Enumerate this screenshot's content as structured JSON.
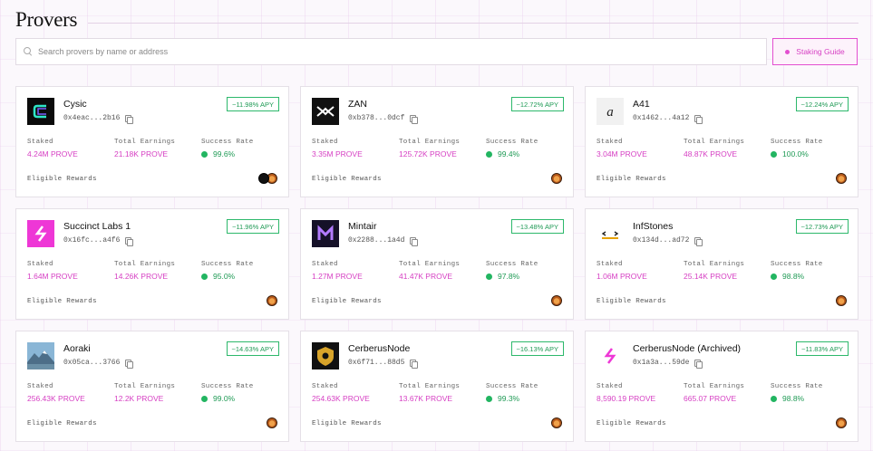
{
  "page": {
    "title": "Provers",
    "search_placeholder": "Search provers by name or address",
    "staking_guide_label": "Staking Guide"
  },
  "labels": {
    "staked": "Staked",
    "total_earnings": "Total Earnings",
    "success_rate": "Success Rate",
    "eligible_rewards": "Eligible Rewards"
  },
  "provers": [
    {
      "name": "Cysic",
      "address": "0x4eac...2b16",
      "apy": "~11.98% APY",
      "staked": "4.24M PROVE",
      "earnings": "21.18K PROVE",
      "success": "99.6%",
      "logo": "cysic-logo",
      "rewards": [
        "dark-token-icon",
        "prove-token-icon"
      ]
    },
    {
      "name": "ZAN",
      "address": "0xb378...0dcf",
      "apy": "~12.72% APY",
      "staked": "3.35M PROVE",
      "earnings": "125.72K PROVE",
      "success": "99.4%",
      "logo": "zan-logo",
      "rewards": [
        "prove-token-icon"
      ]
    },
    {
      "name": "A41",
      "address": "0x1462...4a12",
      "apy": "~12.24% APY",
      "staked": "3.04M PROVE",
      "earnings": "48.87K PROVE",
      "success": "100.0%",
      "logo": "a41-logo",
      "rewards": [
        "prove-token-icon"
      ]
    },
    {
      "name": "Succinct Labs 1",
      "address": "0x16fc...a4f6",
      "apy": "~11.96% APY",
      "staked": "1.64M PROVE",
      "earnings": "14.26K PROVE",
      "success": "95.0%",
      "logo": "succinct-logo",
      "rewards": [
        "prove-token-icon"
      ]
    },
    {
      "name": "Mintair",
      "address": "0x2288...1a4d",
      "apy": "~13.48% APY",
      "staked": "1.27M PROVE",
      "earnings": "41.47K PROVE",
      "success": "97.8%",
      "logo": "mintair-logo",
      "rewards": [
        "prove-token-icon"
      ]
    },
    {
      "name": "InfStones",
      "address": "0x134d...ad72",
      "apy": "~12.73% APY",
      "staked": "1.06M PROVE",
      "earnings": "25.14K PROVE",
      "success": "98.8%",
      "logo": "infstones-logo",
      "rewards": [
        "prove-token-icon"
      ]
    },
    {
      "name": "Aoraki",
      "address": "0x05ca...3766",
      "apy": "~14.63% APY",
      "staked": "256.43K PROVE",
      "earnings": "12.2K PROVE",
      "success": "99.0%",
      "logo": "aoraki-logo",
      "rewards": [
        "prove-token-icon"
      ]
    },
    {
      "name": "CerberusNode",
      "address": "0x6f71...88d5",
      "apy": "~16.13% APY",
      "staked": "254.63K PROVE",
      "earnings": "13.67K PROVE",
      "success": "99.3%",
      "logo": "cerberus-logo",
      "rewards": [
        "prove-token-icon"
      ]
    },
    {
      "name": "CerberusNode (Archived)",
      "address": "0x1a3a...59de",
      "apy": "~11.83% APY",
      "staked": "8,590.19 PROVE",
      "earnings": "665.07 PROVE",
      "success": "98.8%",
      "logo": "cerberus-archived-logo",
      "rewards": [
        "prove-token-icon"
      ]
    }
  ],
  "colors": {
    "accent_pink": "#d63fc3",
    "apy_green": "#1f9a55",
    "border": "#e5e0e7"
  }
}
